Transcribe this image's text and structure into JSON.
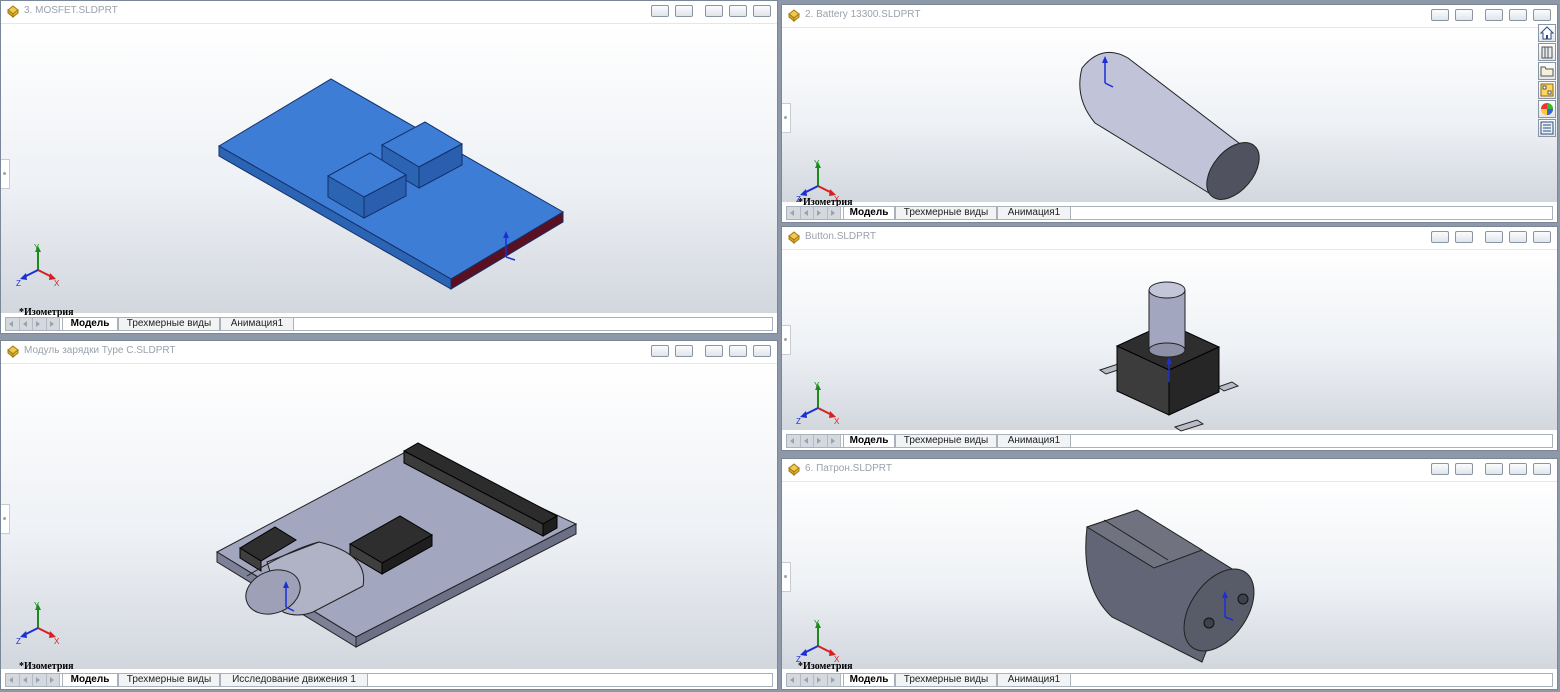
{
  "windows": {
    "mosfet": {
      "title": "3. MOSFET.SLDPRT",
      "view_label": "*Изометрия",
      "tabs": [
        "Модель",
        "Трехмерные виды",
        "Анимация1"
      ]
    },
    "charger": {
      "title": "Модуль зарядки Type C.SLDPRT",
      "view_label": "*Изометрия",
      "tabs": [
        "Модель",
        "Трехмерные виды",
        "Исследование движения 1"
      ]
    },
    "battery": {
      "title": "2. Battery 13300.SLDPRT",
      "view_label": "*Изометрия",
      "tabs": [
        "Модель",
        "Трехмерные виды",
        "Анимация1"
      ]
    },
    "button": {
      "title": "Button.SLDPRT",
      "view_label": "",
      "tabs": [
        "Модель",
        "Трехмерные виды",
        "Анимация1"
      ]
    },
    "patron": {
      "title": "6. Патрон.SLDPRT",
      "view_label": "*Изометрия",
      "tabs": [
        "Модель",
        "Трехмерные виды",
        "Анимация1"
      ]
    }
  },
  "triad_axes": {
    "x": "X",
    "y": "Y",
    "z": "Z"
  },
  "task_pane": [
    "home-icon",
    "design-library-icon",
    "file-explorer-icon",
    "view-palette-icon",
    "appearances-icon",
    "custom-properties-icon"
  ],
  "colors": {
    "mosfet_board": "#3a78d0",
    "part_gray": "#9a9eb4",
    "dark_component": "#2c2c2c",
    "axis_x": "#d62020",
    "axis_y": "#1a8a1a",
    "axis_z": "#1a2fd6"
  }
}
